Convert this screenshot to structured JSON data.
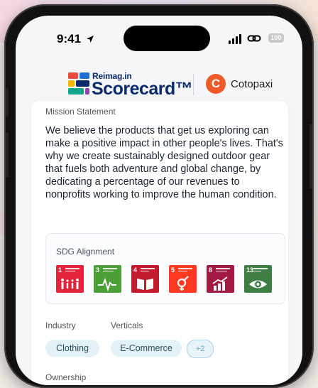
{
  "status_bar": {
    "time": "9:41",
    "battery": "100"
  },
  "brand": {
    "reimag_small": "Reimag.in",
    "reimag_big": "Scorecard™",
    "partner_initial": "C",
    "partner_name": "Cotopaxi",
    "partner_color": "#f05a28"
  },
  "mission": {
    "label": "Mission Statement",
    "text": "We believe the products that get us exploring can make a positive impact in other people's lives. That's why we create sustainably designed outdoor gear that fuels both adventure and global change, by dedicating a percentage of our revenues to nonprofits working to improve the human condition."
  },
  "sdg": {
    "title": "SDG Alignment",
    "goals": [
      {
        "number": "1",
        "color": "#e5243b",
        "icon": "family-icon"
      },
      {
        "number": "3",
        "color": "#4c9f38",
        "icon": "heartbeat-icon"
      },
      {
        "number": "4",
        "color": "#c5192d",
        "icon": "book-icon"
      },
      {
        "number": "5",
        "color": "#ff3a21",
        "icon": "gender-icon"
      },
      {
        "number": "8",
        "color": "#a21942",
        "icon": "growth-chart-icon"
      },
      {
        "number": "13",
        "color": "#3f7e44",
        "icon": "eye-globe-icon"
      }
    ]
  },
  "industry": {
    "label": "Industry",
    "value": "Clothing"
  },
  "verticals": {
    "label": "Verticals",
    "value": "E-Commerce",
    "more": "+2"
  },
  "ownership": {
    "label": "Ownership"
  }
}
